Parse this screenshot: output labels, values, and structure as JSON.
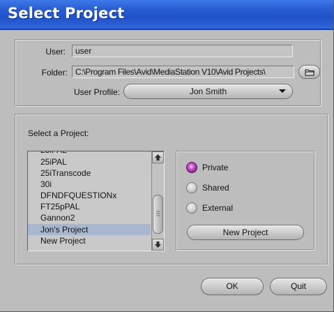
{
  "window": {
    "title": "Select Project"
  },
  "top_panel": {
    "user_label": "User:",
    "user_value": "user",
    "folder_label": "Folder:",
    "folder_value": "C:\\Program Files\\Avid\\MediaStation V10\\Avid Projects\\",
    "folder_browse_icon": "folder-icon",
    "profile_label": "User Profile:",
    "profile_value": "Jon Smith"
  },
  "project_panel": {
    "list_label": "Select a Project:",
    "projects": [
      "25iPAL",
      "25iTranscode",
      "30i",
      "DFNDFQUESTIONx",
      "FT25pPAL",
      "Gannon2",
      "Jon's Project",
      "New Project"
    ],
    "selected_project": "Jon's Project",
    "scope_options": [
      "Private",
      "Shared",
      "External"
    ],
    "selected_scope": "Private",
    "new_project_label": "New Project"
  },
  "footer": {
    "ok_label": "OK",
    "quit_label": "Quit"
  },
  "colors": {
    "title_bar": "#2a5fd4",
    "dialog_bg": "#bdbdbd",
    "selection": "#a9b6cf",
    "radio_selected": "#b23cb6"
  }
}
